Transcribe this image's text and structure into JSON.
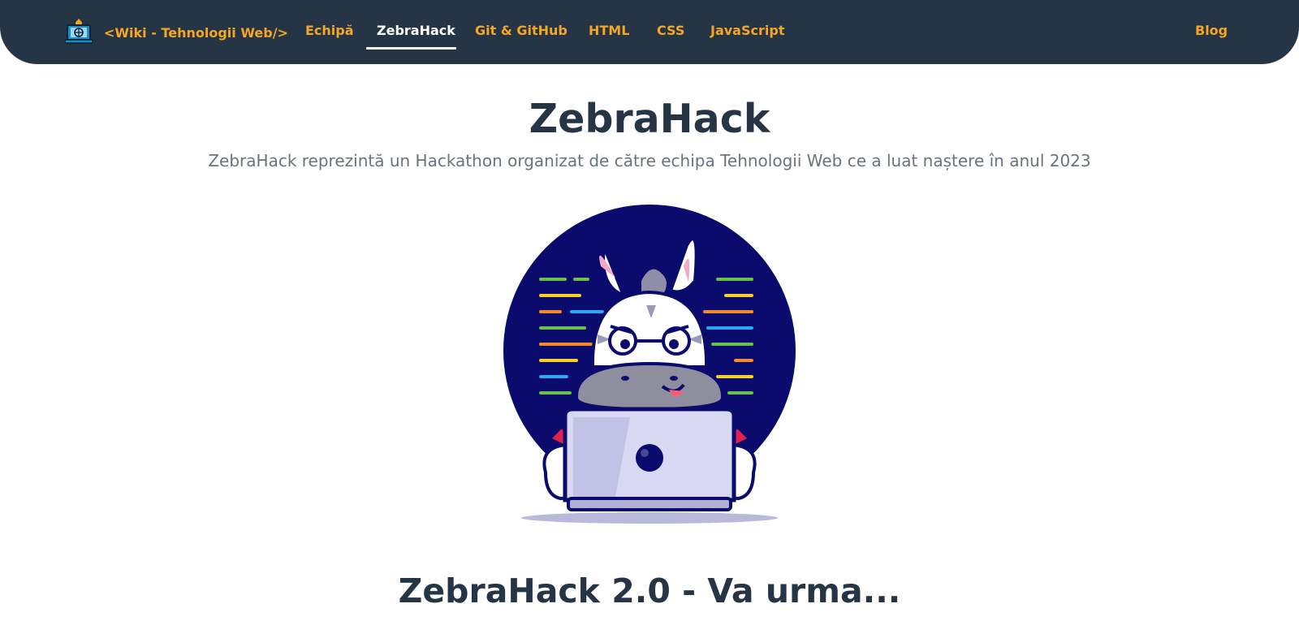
{
  "nav": {
    "brand": "<Wiki - Tehnologii Web/>",
    "brand_icon": "laptop-globe-icon",
    "items": [
      {
        "label": "Echipă",
        "active": false
      },
      {
        "label": "ZebraHack",
        "active": true
      },
      {
        "label": "Git & GitHub",
        "active": false
      },
      {
        "label": "HTML",
        "active": false
      },
      {
        "label": "CSS",
        "active": false
      },
      {
        "label": "JavaScript",
        "active": false
      }
    ],
    "blog": "Blog"
  },
  "main": {
    "title": "ZebraHack",
    "subtitle": "ZebraHack reprezintă un Hackathon organizat de către echipa Tehnologii Web ce a luat naștere în anul 2023",
    "illustration_icon": "zebra-coding-laptop-illustration",
    "section_title": "ZebraHack 2.0 - Va urma..."
  },
  "colors": {
    "nav_bg": "#263545",
    "accent": "#f5a623",
    "heading": "#263545",
    "subtitle": "#6b7280",
    "illustration_bg": "#0b0b6e"
  }
}
